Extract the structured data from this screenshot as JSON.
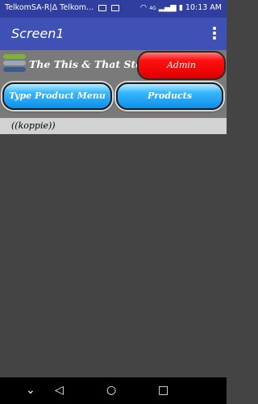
{
  "status_bar": {
    "carrier_text": "TelkomSA-R|Δ Telkom...",
    "time": "10:13 AM",
    "signal_text": "4G"
  },
  "app_bar": {
    "title": "Screen1"
  },
  "header": {
    "store_name": "The This & That Store",
    "admin_button": "Admin",
    "type_product_menu_button": "Type Product Menu",
    "products_button": "Products"
  },
  "section_header": {
    "text": "((koppie))"
  },
  "colors": {
    "status_bar": "#303f9f",
    "app_bar": "#3f51b5",
    "header_bg": "#7a7a7a",
    "content_bg": "#444444",
    "admin_red": "#ff1010",
    "products_blue": "#1b9ff0"
  },
  "logo": {
    "bars": [
      "#7fb13a",
      "#9aa7b4",
      "#3b5a8f"
    ]
  }
}
